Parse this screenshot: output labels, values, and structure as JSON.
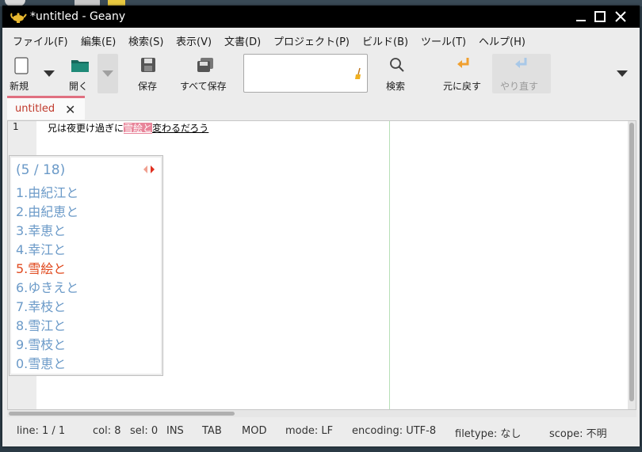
{
  "window": {
    "title": "*untitled - Geany"
  },
  "menubar": [
    {
      "label": "ファイル(F)"
    },
    {
      "label": "編集(E)"
    },
    {
      "label": "検索(S)"
    },
    {
      "label": "表示(V)"
    },
    {
      "label": "文書(D)"
    },
    {
      "label": "プロジェクト(P)"
    },
    {
      "label": "ビルド(B)"
    },
    {
      "label": "ツール(T)"
    },
    {
      "label": "ヘルプ(H)"
    }
  ],
  "toolbar": {
    "new_label": "新規",
    "open_label": "開く",
    "save_label": "保存",
    "save_all_label": "すべて保存",
    "search_label": "検索",
    "undo_label": "元に戻す",
    "redo_label": "やり直す",
    "search_value": ""
  },
  "tabs": [
    {
      "label": "untitled",
      "close": "✕"
    }
  ],
  "editor": {
    "line_number": "1",
    "text_before": "兄は夜更け過ぎに",
    "text_highlight": "雪絵と",
    "text_after": "変わるだろう"
  },
  "candidates": {
    "page": "(5 / 18)",
    "items": [
      {
        "label": "1.由紀江と"
      },
      {
        "label": "2.由紀恵と"
      },
      {
        "label": "3.幸恵と"
      },
      {
        "label": "4.幸江と"
      },
      {
        "label": "5.雪絵と"
      },
      {
        "label": "6.ゆきえと"
      },
      {
        "label": "7.幸枝と"
      },
      {
        "label": "8.雪江と"
      },
      {
        "label": "9.雪枝と"
      },
      {
        "label": "0.雪恵と"
      }
    ],
    "selected_index": 4
  },
  "statusbar": {
    "line": "line: 1 / 1",
    "col": "col: 8",
    "sel": "sel: 0",
    "ins": "INS",
    "tab": "TAB",
    "mod": "MOD",
    "mode": "mode: LF",
    "encoding": "encoding: UTF-8",
    "filetype": "filetype: なし",
    "scope": "scope: 不明"
  },
  "colors": {
    "accent_tab": "#e07080",
    "highlight": "#e8859a",
    "candidate_text": "#6b9ac8",
    "candidate_selected": "#e04a1f",
    "undo_icon": "#f0a030",
    "redo_icon": "#a8c8e8"
  },
  "icons": {
    "app": "geany-lamp-icon",
    "new": "new-document-icon",
    "open": "folder-icon",
    "save": "floppy-icon",
    "save_all": "floppy-stack-icon",
    "search": "magnifier-icon",
    "undo": "undo-arrow-icon",
    "redo": "redo-arrow-icon",
    "clear": "broom-icon"
  }
}
